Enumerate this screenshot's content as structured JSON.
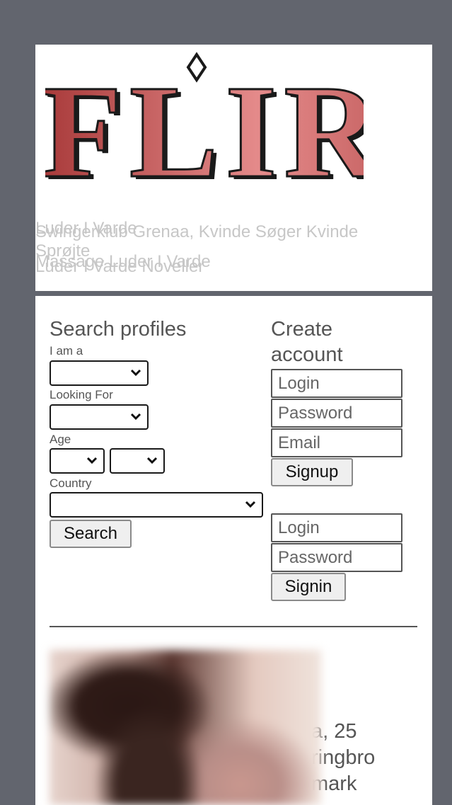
{
  "logo": {
    "text": "FLIRT"
  },
  "header_links": {
    "line1a": "Luder I Varde",
    "line1b": "Swingerklub Grenaa, Kvinde Søger Kvinde",
    "line2a": "Sprøjte",
    "line2b": "Massage Luder I Varde",
    "line2c": "Luder I Varde Noveller"
  },
  "search": {
    "title": "Search profiles",
    "i_am_label": "I am a",
    "looking_for_label": "Looking For",
    "age_label": "Age",
    "country_label": "Country",
    "button": "Search"
  },
  "signup": {
    "title_line1": "Create",
    "title_line2": "account",
    "login_placeholder": "Login",
    "password_placeholder": "Password",
    "email_placeholder": "Email",
    "button": "Signup"
  },
  "signin": {
    "login_placeholder": "Login",
    "password_placeholder": "Password",
    "button": "Signin"
  },
  "profile": {
    "line1": "a, 25",
    "line2": "ringbro",
    "line3": "mark"
  }
}
